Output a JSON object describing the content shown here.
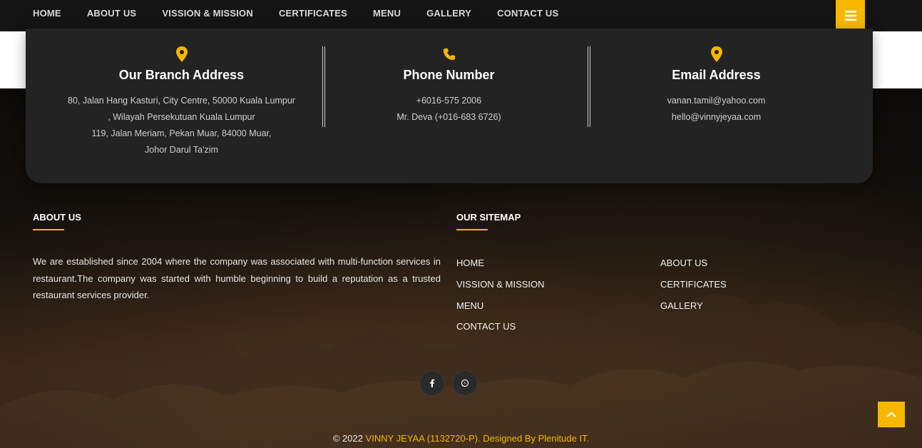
{
  "nav": {
    "items": [
      {
        "label": "HOME"
      },
      {
        "label": "ABOUT US"
      },
      {
        "label": "VISSION & MISSION"
      },
      {
        "label": "CERTIFICATES"
      },
      {
        "label": "MENU"
      },
      {
        "label": "GALLERY"
      },
      {
        "label": "CONTACT US"
      }
    ],
    "menu_icon": "hamburger-icon"
  },
  "contact": {
    "branch": {
      "icon": "map-pin-icon",
      "title": "Our Branch Address",
      "lines": [
        "80, Jalan Hang Kasturi, City Centre, 50000 Kuala Lumpur",
        ", Wilayah Persekutuan Kuala Lumpur",
        "119, Jalan Meriam, Pekan Muar, 84000 Muar,",
        "Johor Darul Ta'zim"
      ]
    },
    "phone": {
      "icon": "phone-icon",
      "title": "Phone Number",
      "lines": [
        "+6016-575 2006",
        "Mr. Deva (+016-683 6726)"
      ]
    },
    "email": {
      "icon": "map-pin-icon",
      "title": "Email Address",
      "lines": [
        "vanan.tamil@yahoo.com",
        "hello@vinnyjeyaa.com"
      ]
    }
  },
  "about": {
    "title": "ABOUT US",
    "text": "We are established since 2004 where the company was associated with multi-function services in restaurant.The company was started with humble beginning to build a reputation as a trusted restaurant services provider."
  },
  "sitemap": {
    "title": "OUR SITEMAP",
    "left": [
      "HOME",
      "VISSION & MISSION",
      "MENU",
      "CONTACT US"
    ],
    "right": [
      "ABOUT US",
      "CERTIFICATES",
      "GALLERY"
    ]
  },
  "social": [
    {
      "icon": "facebook-icon"
    },
    {
      "icon": "whatsapp-icon"
    }
  ],
  "footer": {
    "copyright_prefix": "© 2022 ",
    "company": "VINNY JEYAA (1132720-P)",
    "designed_by": ". Designed By Plenitude IT."
  },
  "colors": {
    "accent": "#f5b700",
    "nav_bg": "#141414",
    "card_bg": "#232323"
  }
}
